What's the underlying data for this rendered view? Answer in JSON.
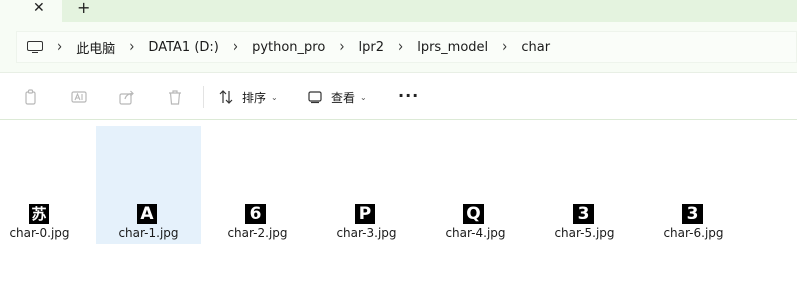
{
  "tabbar": {
    "close_glyph": "✕",
    "new_tab_glyph": "+"
  },
  "breadcrumb": {
    "icon": "computer-icon",
    "separator": "›",
    "items": [
      "此电脑",
      "DATA1 (D:)",
      "python_pro",
      "lpr2",
      "lprs_model",
      "char"
    ]
  },
  "toolbar": {
    "icons": [
      "copy-icon",
      "rename-icon",
      "share-icon",
      "delete-icon"
    ],
    "sort_label": "排序",
    "view_label": "查看",
    "more_label": "···"
  },
  "files": [
    {
      "name": "char-0.jpg",
      "glyph": "苏",
      "selected": false
    },
    {
      "name": "char-1.jpg",
      "glyph": "A",
      "selected": true
    },
    {
      "name": "char-2.jpg",
      "glyph": "6",
      "selected": false
    },
    {
      "name": "char-3.jpg",
      "glyph": "P",
      "selected": false
    },
    {
      "name": "char-4.jpg",
      "glyph": "Q",
      "selected": false
    },
    {
      "name": "char-5.jpg",
      "glyph": "3",
      "selected": false
    },
    {
      "name": "char-6.jpg",
      "glyph": "3",
      "selected": false
    }
  ],
  "colors": {
    "tabbar_bg": "#e4f3df",
    "selection": "#e5f1fb",
    "address_bg": "#f7fcf5"
  }
}
